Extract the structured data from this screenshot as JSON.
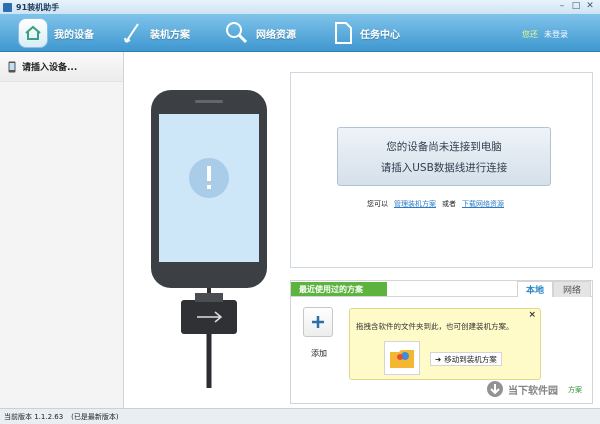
{
  "titlebar": {
    "title": "91装机助手"
  },
  "nav": {
    "items": [
      {
        "label": "我的设备"
      },
      {
        "label": "装机方案"
      },
      {
        "label": "网络资源"
      },
      {
        "label": "任务中心"
      }
    ],
    "login_prompt": "您还",
    "login_link": "未登录"
  },
  "sidebar": {
    "items": [
      {
        "label": "请插入设备..."
      }
    ]
  },
  "connection": {
    "line1": "您的设备尚未连接到电脑",
    "line2": "请插入USB数据线进行连接",
    "hint_prefix": "您可以",
    "hint_link1": "管理装机方案",
    "hint_or": "或者",
    "hint_link2": "下载网络资源"
  },
  "plans": {
    "recent_tab": "最近使用过的方案",
    "local_tab": "本地",
    "network_tab": "网络",
    "add_label": "添加",
    "tooltip_text": "拖拽含软件的文件夹到此，也可创建装机方案。",
    "tooltip_close": "×",
    "move_label": "移动到装机方案",
    "corner_link": "方案"
  },
  "status": {
    "version": "当前版本 1.1.2.63",
    "note": "(已是最新版本)"
  },
  "watermark": {
    "text": "当下软件园"
  },
  "colors": {
    "toolbar": "#4aa3d8",
    "recent_tab": "#5cb43f",
    "tooltip": "#fffbc9"
  }
}
